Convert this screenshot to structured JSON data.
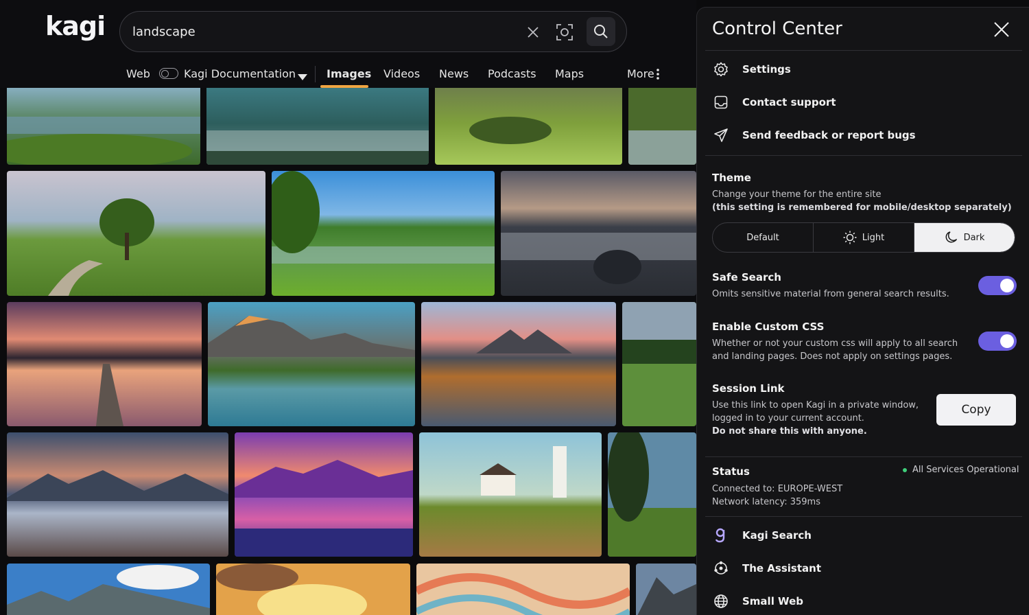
{
  "header": {
    "logo": "kagi",
    "search": {
      "value": "landscape",
      "placeholder": ""
    },
    "nav": {
      "web": "Web",
      "lens": "Kagi Documentation",
      "tabs": [
        "Images",
        "Videos",
        "News",
        "Podcasts",
        "Maps"
      ],
      "more": "More",
      "active_tab": "Images"
    }
  },
  "panel": {
    "title": "Control Center",
    "menu": [
      {
        "label": "Settings",
        "icon": "gear-icon"
      },
      {
        "label": "Contact support",
        "icon": "inbox-icon"
      },
      {
        "label": "Send feedback or report bugs",
        "icon": "send-icon"
      }
    ],
    "theme": {
      "title": "Theme",
      "desc1": "Change your theme for the entire site",
      "desc2": "(this setting is remembered for mobile/desktop separately)",
      "options": [
        "Default",
        "Light",
        "Dark"
      ],
      "selected": "Dark"
    },
    "safe_search": {
      "title": "Safe Search",
      "desc": "Omits sensitive material from general search results.",
      "enabled": true
    },
    "custom_css": {
      "title": "Enable Custom CSS",
      "desc1": "Whether or not your custom css will apply to all search",
      "desc2": "and landing pages. Does not apply on settings pages.",
      "enabled": true
    },
    "session_link": {
      "title": "Session Link",
      "desc1": "Use this link to open Kagi in a private window,",
      "desc2": "logged in to your current account.",
      "warning": "Do not share this with anyone.",
      "button": "Copy"
    },
    "status": {
      "title": "Status",
      "badge": "All Services Operational",
      "connected": "Connected to: EUROPE-WEST",
      "latency": "Network latency: 359ms",
      "dot_color": "#3fcf7a"
    },
    "products": [
      {
        "label": "Kagi Search",
        "icon": "kagi-g-icon"
      },
      {
        "label": "The Assistant",
        "icon": "assistant-icon"
      },
      {
        "label": "Small Web",
        "icon": "globe-icon"
      }
    ]
  },
  "colors": {
    "accent": "#6b5fe0",
    "active_tab": "#f0a441",
    "link": "#b7a8ff"
  }
}
